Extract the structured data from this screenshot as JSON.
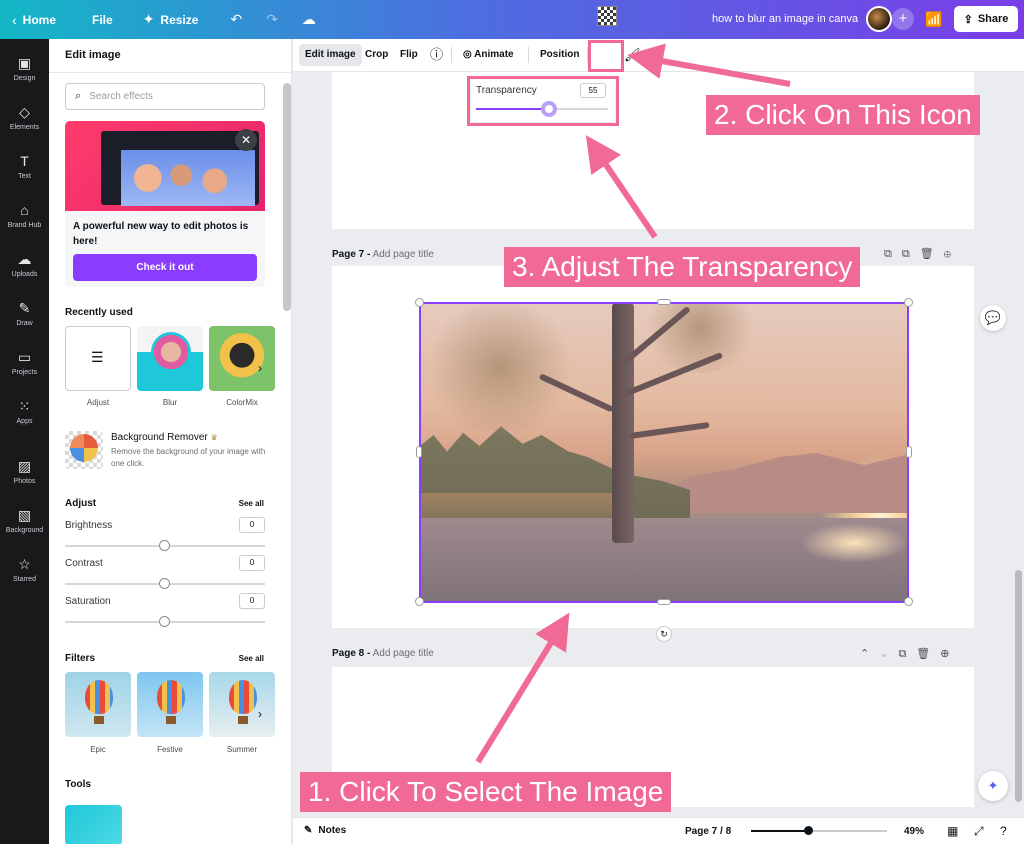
{
  "topbar": {
    "home": "Home",
    "file": "File",
    "resize": "Resize",
    "doc_title": "how to blur an image in canva",
    "share": "Share"
  },
  "rail": [
    {
      "label": "Design",
      "icon": "layout-icon"
    },
    {
      "label": "Elements",
      "icon": "shapes-icon"
    },
    {
      "label": "Text",
      "icon": "text-icon"
    },
    {
      "label": "Brand Hub",
      "icon": "brand-icon"
    },
    {
      "label": "Uploads",
      "icon": "cloud-upload-icon"
    },
    {
      "label": "Draw",
      "icon": "pen-icon"
    },
    {
      "label": "Projects",
      "icon": "folder-icon"
    },
    {
      "label": "Apps",
      "icon": "grid-icon"
    },
    {
      "label": "Photos",
      "icon": "image-icon"
    },
    {
      "label": "Background",
      "icon": "stripes-icon"
    },
    {
      "label": "Starred",
      "icon": "star-icon"
    }
  ],
  "panel": {
    "title": "Edit image",
    "search_placeholder": "Search effects",
    "promo_text": "A powerful new way to edit photos is here!",
    "promo_button": "Check it out",
    "recently_used": "Recently used",
    "recent_items": [
      "Adjust",
      "Blur",
      "ColorMix"
    ],
    "bg_remover_title": "Background Remover",
    "bg_remover_desc": "Remove the background of your image with one click.",
    "adjust_title": "Adjust",
    "see_all": "See all",
    "sliders": [
      {
        "label": "Brightness",
        "value": "0"
      },
      {
        "label": "Contrast",
        "value": "0"
      },
      {
        "label": "Saturation",
        "value": "0"
      }
    ],
    "filters_title": "Filters",
    "filters": [
      "Epic",
      "Festive",
      "Summer"
    ],
    "tools_title": "Tools"
  },
  "context_toolbar": {
    "edit_image": "Edit image",
    "crop": "Crop",
    "flip": "Flip",
    "animate": "Animate",
    "position": "Position"
  },
  "transparency": {
    "label": "Transparency",
    "value": "55",
    "fraction": 0.55
  },
  "pages": {
    "page7_label": "Page 7 -",
    "page8_label": "Page 8 -",
    "add_title": "Add page title"
  },
  "bottombar": {
    "notes": "Notes",
    "page_indicator": "Page 7 / 8",
    "zoom": "49%",
    "zoom_fraction": 0.42
  },
  "callouts": {
    "step1": "1. Click To Select The Image",
    "step2": "2. Click On This Icon",
    "step3": "3. Adjust The Transparency"
  },
  "colors": {
    "accent": "#8b3dff",
    "callout": "#f06a95",
    "rail_bg": "#18191b"
  }
}
